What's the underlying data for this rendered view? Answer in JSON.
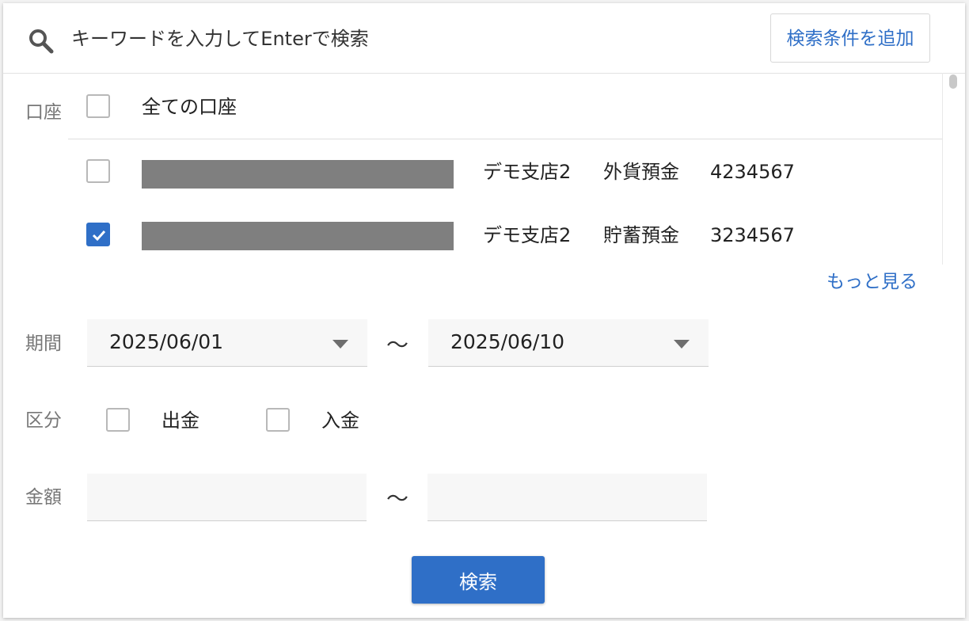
{
  "search": {
    "placeholder": "キーワードを入力してEnterで検索",
    "add_condition_label": "検索条件を追加"
  },
  "accounts": {
    "label": "口座",
    "all_label": "全ての口座",
    "all_checked": false,
    "items": [
      {
        "branch": "デモ支店2",
        "type": "外貨預金",
        "number": "4234567",
        "checked": false
      },
      {
        "branch": "デモ支店2",
        "type": "貯蓄預金",
        "number": "3234567",
        "checked": true
      }
    ],
    "more_label": "もっと見る"
  },
  "period": {
    "label": "期間",
    "from": "2025/06/01",
    "to": "2025/06/10",
    "separator": "〜"
  },
  "category": {
    "label": "区分",
    "options": [
      {
        "label": "出金",
        "checked": false
      },
      {
        "label": "入金",
        "checked": false
      }
    ]
  },
  "amount": {
    "label": "金額",
    "separator": "〜",
    "min": "",
    "max": ""
  },
  "submit_label": "検索",
  "colors": {
    "accent": "#2f6fc7",
    "mask": "#7f7f7f"
  },
  "icons": {
    "search": "search-icon",
    "caret": "caret-down-icon",
    "check": "check-icon"
  }
}
